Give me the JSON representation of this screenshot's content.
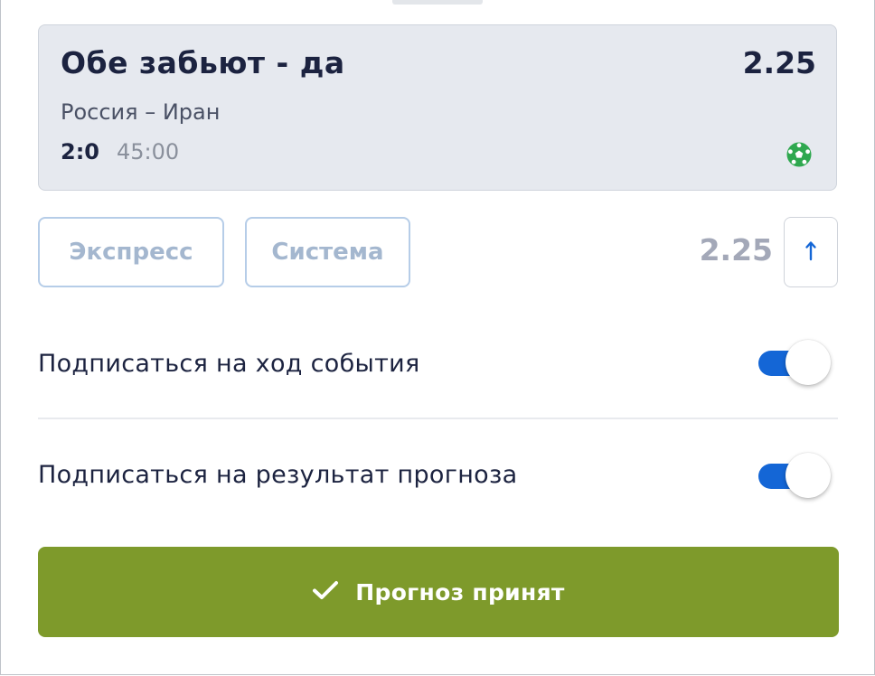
{
  "bet": {
    "title": "Обе забьют - да",
    "odds": "2.25",
    "match": "Россия – Иран",
    "score": "2:0",
    "time": "45:00",
    "sport_icon": "soccer-ball-icon"
  },
  "bet_types": {
    "express_label": "Экспресс",
    "system_label": "Система",
    "total_odds": "2.25",
    "arrow_icon": "arrow-up-icon"
  },
  "subscriptions": [
    {
      "label": "Подписаться на ход события",
      "enabled": true
    },
    {
      "label": "Подписаться на результат прогноза",
      "enabled": true
    }
  ],
  "submit": {
    "label": "Прогноз принят",
    "icon": "checkmark-icon"
  },
  "colors": {
    "accent_blue": "#1466d6",
    "accept_green": "#7e9a2b",
    "sport_icon_green": "#2fa84f",
    "text_dark": "#1c2340"
  }
}
